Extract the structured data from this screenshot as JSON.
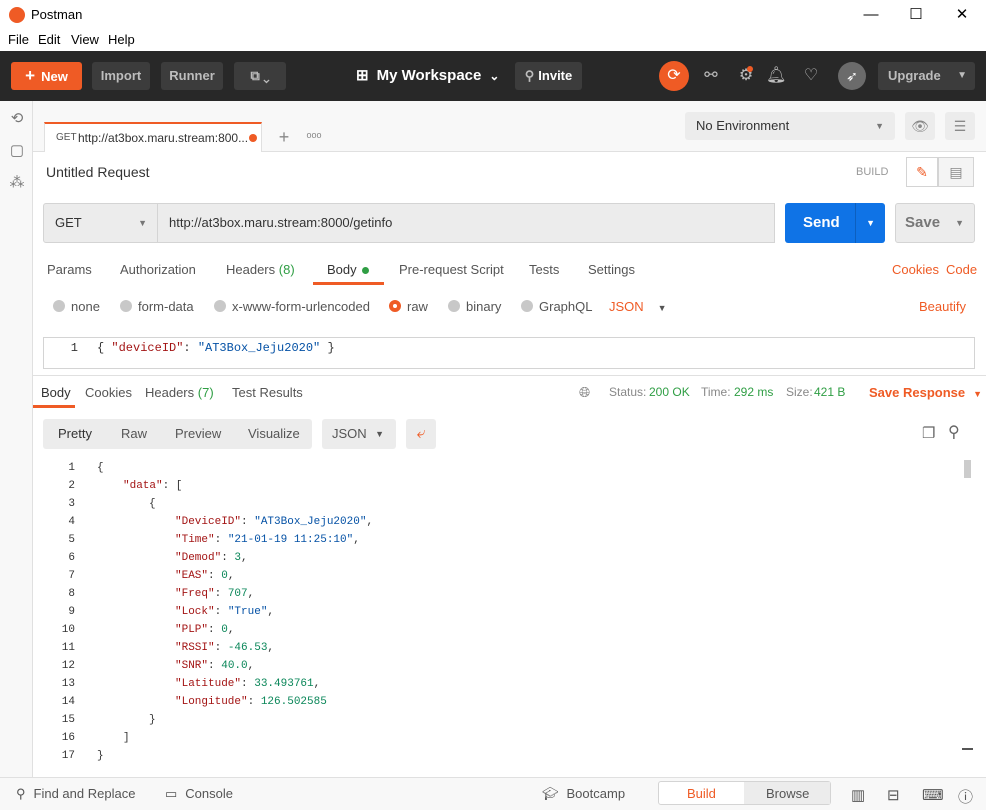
{
  "window": {
    "title": "Postman",
    "minimize": "—",
    "maximize": "☐",
    "close": "✕"
  },
  "menu": [
    "File",
    "Edit",
    "View",
    "Help"
  ],
  "toolbar": {
    "new_label": "New",
    "import_label": "Import",
    "runner_label": "Runner",
    "workspace_label": "My Workspace",
    "invite_label": "Invite",
    "upgrade_label": "Upgrade"
  },
  "tab": {
    "method": "GET",
    "title": "http://at3box.maru.stream:800...",
    "add": "+",
    "more": "ooo"
  },
  "environment": {
    "selected": "No Environment"
  },
  "request": {
    "name": "Untitled Request",
    "build_label": "BUILD",
    "method": "GET",
    "url": "http://at3box.maru.stream:8000/getinfo",
    "send_label": "Send",
    "save_label": "Save"
  },
  "request_tabs": {
    "params": "Params",
    "authorization": "Authorization",
    "headers": "Headers",
    "headers_count": "(8)",
    "body": "Body",
    "prerequest": "Pre-request Script",
    "tests": "Tests",
    "settings": "Settings",
    "cookies": "Cookies",
    "code": "Code"
  },
  "body_options": {
    "none": "none",
    "form_data": "form-data",
    "urlencoded": "x-www-form-urlencoded",
    "raw": "raw",
    "binary": "binary",
    "graphql": "GraphQL",
    "format": "JSON",
    "beautify": "Beautify"
  },
  "request_body": {
    "line_no": "1",
    "open": "{ ",
    "key": "\"deviceID\"",
    "colon": ": ",
    "value": "\"AT3Box_Jeju2020\"",
    "close": " }"
  },
  "response_tabs": {
    "body": "Body",
    "cookies": "Cookies",
    "headers": "Headers",
    "headers_count": "(7)",
    "test_results": "Test Results"
  },
  "response_meta": {
    "status_label": "Status:",
    "status_value": "200 OK",
    "time_label": "Time:",
    "time_value": "292 ms",
    "size_label": "Size:",
    "size_value": "421 B",
    "save_response": "Save Response"
  },
  "view_buttons": {
    "pretty": "Pretty",
    "raw": "Raw",
    "preview": "Preview",
    "visualize": "Visualize",
    "format": "JSON"
  },
  "response_lines": [
    {
      "n": "1",
      "indent": 0,
      "parts": [
        {
          "t": "{",
          "c": "p"
        }
      ]
    },
    {
      "n": "2",
      "indent": 1,
      "parts": [
        {
          "t": "\"data\"",
          "c": "k"
        },
        {
          "t": ": [",
          "c": "p"
        }
      ]
    },
    {
      "n": "3",
      "indent": 2,
      "parts": [
        {
          "t": "{",
          "c": "p"
        }
      ]
    },
    {
      "n": "4",
      "indent": 3,
      "parts": [
        {
          "t": "\"DeviceID\"",
          "c": "k"
        },
        {
          "t": ": ",
          "c": "p"
        },
        {
          "t": "\"AT3Box_Jeju2020\"",
          "c": "s"
        },
        {
          "t": ",",
          "c": "p"
        }
      ]
    },
    {
      "n": "5",
      "indent": 3,
      "parts": [
        {
          "t": "\"Time\"",
          "c": "k"
        },
        {
          "t": ": ",
          "c": "p"
        },
        {
          "t": "\"21-01-19 11:25:10\"",
          "c": "s"
        },
        {
          "t": ",",
          "c": "p"
        }
      ]
    },
    {
      "n": "6",
      "indent": 3,
      "parts": [
        {
          "t": "\"Demod\"",
          "c": "k"
        },
        {
          "t": ": ",
          "c": "p"
        },
        {
          "t": "3",
          "c": "n"
        },
        {
          "t": ",",
          "c": "p"
        }
      ]
    },
    {
      "n": "7",
      "indent": 3,
      "parts": [
        {
          "t": "\"EAS\"",
          "c": "k"
        },
        {
          "t": ": ",
          "c": "p"
        },
        {
          "t": "0",
          "c": "n"
        },
        {
          "t": ",",
          "c": "p"
        }
      ]
    },
    {
      "n": "8",
      "indent": 3,
      "parts": [
        {
          "t": "\"Freq\"",
          "c": "k"
        },
        {
          "t": ": ",
          "c": "p"
        },
        {
          "t": "707",
          "c": "n"
        },
        {
          "t": ",",
          "c": "p"
        }
      ]
    },
    {
      "n": "9",
      "indent": 3,
      "parts": [
        {
          "t": "\"Lock\"",
          "c": "k"
        },
        {
          "t": ": ",
          "c": "p"
        },
        {
          "t": "\"True\"",
          "c": "s"
        },
        {
          "t": ",",
          "c": "p"
        }
      ]
    },
    {
      "n": "10",
      "indent": 3,
      "parts": [
        {
          "t": "\"PLP\"",
          "c": "k"
        },
        {
          "t": ": ",
          "c": "p"
        },
        {
          "t": "0",
          "c": "n"
        },
        {
          "t": ",",
          "c": "p"
        }
      ]
    },
    {
      "n": "11",
      "indent": 3,
      "parts": [
        {
          "t": "\"RSSI\"",
          "c": "k"
        },
        {
          "t": ": ",
          "c": "p"
        },
        {
          "t": "-46.53",
          "c": "n"
        },
        {
          "t": ",",
          "c": "p"
        }
      ]
    },
    {
      "n": "12",
      "indent": 3,
      "parts": [
        {
          "t": "\"SNR\"",
          "c": "k"
        },
        {
          "t": ": ",
          "c": "p"
        },
        {
          "t": "40.0",
          "c": "n"
        },
        {
          "t": ",",
          "c": "p"
        }
      ]
    },
    {
      "n": "13",
      "indent": 3,
      "parts": [
        {
          "t": "\"Latitude\"",
          "c": "k"
        },
        {
          "t": ": ",
          "c": "p"
        },
        {
          "t": "33.493761",
          "c": "n"
        },
        {
          "t": ",",
          "c": "p"
        }
      ]
    },
    {
      "n": "14",
      "indent": 3,
      "parts": [
        {
          "t": "\"Longitude\"",
          "c": "k"
        },
        {
          "t": ": ",
          "c": "p"
        },
        {
          "t": "126.502585",
          "c": "n"
        }
      ]
    },
    {
      "n": "15",
      "indent": 2,
      "parts": [
        {
          "t": "}",
          "c": "p"
        }
      ]
    },
    {
      "n": "16",
      "indent": 1,
      "parts": [
        {
          "t": "]",
          "c": "p"
        }
      ]
    },
    {
      "n": "17",
      "indent": 0,
      "parts": [
        {
          "t": "}",
          "c": "p"
        }
      ]
    }
  ],
  "statusbar": {
    "find_replace": "Find and Replace",
    "console": "Console",
    "bootcamp": "Bootcamp",
    "build": "Build",
    "browse": "Browse"
  },
  "colors": {
    "accent": "#ef5b25",
    "send": "#0f73e6",
    "status_ok": "#2f9e44"
  }
}
